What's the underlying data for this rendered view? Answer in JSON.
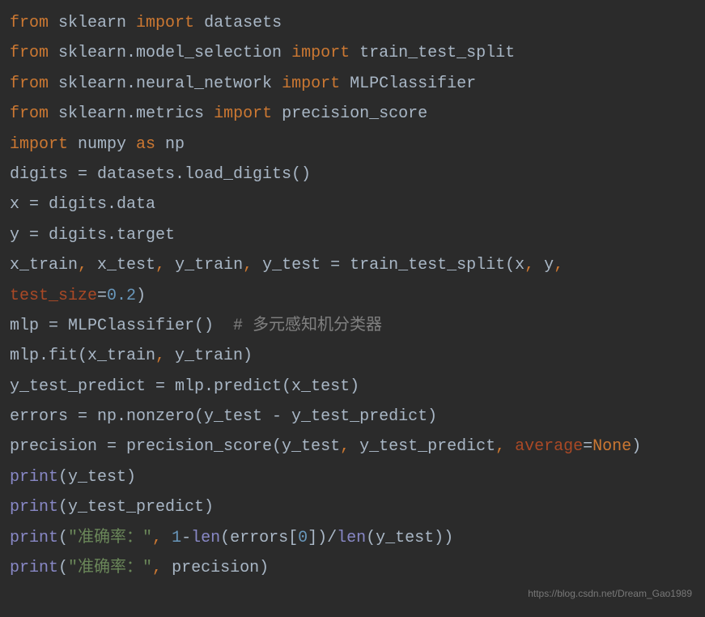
{
  "code": {
    "lines": [
      {
        "tokens": [
          {
            "cls": "kw-import",
            "t": "from"
          },
          {
            "cls": "identifier",
            "t": " sklearn "
          },
          {
            "cls": "kw-import",
            "t": "import"
          },
          {
            "cls": "identifier",
            "t": " datasets"
          }
        ]
      },
      {
        "tokens": [
          {
            "cls": "kw-import",
            "t": "from"
          },
          {
            "cls": "identifier",
            "t": " sklearn.model_selection "
          },
          {
            "cls": "kw-import",
            "t": "import"
          },
          {
            "cls": "identifier",
            "t": " train_test_split"
          }
        ]
      },
      {
        "tokens": [
          {
            "cls": "kw-import",
            "t": "from"
          },
          {
            "cls": "identifier",
            "t": " sklearn.neural_network "
          },
          {
            "cls": "kw-import",
            "t": "import"
          },
          {
            "cls": "identifier",
            "t": " MLPClassifier"
          }
        ]
      },
      {
        "tokens": [
          {
            "cls": "kw-import",
            "t": "from"
          },
          {
            "cls": "identifier",
            "t": " sklearn.metrics "
          },
          {
            "cls": "kw-import",
            "t": "import"
          },
          {
            "cls": "identifier",
            "t": " precision_score"
          }
        ]
      },
      {
        "tokens": [
          {
            "cls": "kw-import",
            "t": "import"
          },
          {
            "cls": "identifier",
            "t": " numpy "
          },
          {
            "cls": "kw-as",
            "t": "as"
          },
          {
            "cls": "identifier",
            "t": " np"
          }
        ]
      },
      {
        "tokens": [
          {
            "cls": "identifier",
            "t": "digits = datasets.load_digits()"
          }
        ]
      },
      {
        "tokens": [
          {
            "cls": "identifier",
            "t": "x = digits.data"
          }
        ]
      },
      {
        "tokens": [
          {
            "cls": "identifier",
            "t": "y = digits.target"
          }
        ]
      },
      {
        "tokens": [
          {
            "cls": "identifier",
            "t": "x_train"
          },
          {
            "cls": "kw-import",
            "t": ", "
          },
          {
            "cls": "identifier",
            "t": "x_test"
          },
          {
            "cls": "kw-import",
            "t": ", "
          },
          {
            "cls": "identifier",
            "t": "y_train"
          },
          {
            "cls": "kw-import",
            "t": ", "
          },
          {
            "cls": "identifier",
            "t": "y_test = train_test_split(x"
          },
          {
            "cls": "kw-import",
            "t": ", "
          },
          {
            "cls": "identifier",
            "t": "y"
          },
          {
            "cls": "kw-import",
            "t": ", "
          },
          {
            "cls": "param",
            "t": "test_size"
          },
          {
            "cls": "identifier",
            "t": "="
          },
          {
            "cls": "number",
            "t": "0.2"
          },
          {
            "cls": "identifier",
            "t": ")"
          }
        ]
      },
      {
        "tokens": [
          {
            "cls": "identifier",
            "t": "mlp = MLPClassifier()  "
          },
          {
            "cls": "comment",
            "t": "# 多元感知机分类器"
          }
        ]
      },
      {
        "tokens": [
          {
            "cls": "identifier",
            "t": "mlp.fit(x_train"
          },
          {
            "cls": "kw-import",
            "t": ", "
          },
          {
            "cls": "identifier",
            "t": "y_train)"
          }
        ]
      },
      {
        "tokens": [
          {
            "cls": "identifier",
            "t": "y_test_predict = mlp.predict(x_test)"
          }
        ]
      },
      {
        "tokens": [
          {
            "cls": "identifier",
            "t": "errors = np.nonzero(y_test - y_test_predict)"
          }
        ]
      },
      {
        "tokens": [
          {
            "cls": "identifier",
            "t": "precision = precision_score(y_test"
          },
          {
            "cls": "kw-import",
            "t": ", "
          },
          {
            "cls": "identifier",
            "t": "y_test_predict"
          },
          {
            "cls": "kw-import",
            "t": ", "
          },
          {
            "cls": "param",
            "t": "average"
          },
          {
            "cls": "identifier",
            "t": "="
          },
          {
            "cls": "kw-none",
            "t": "None"
          },
          {
            "cls": "identifier",
            "t": ")"
          }
        ]
      },
      {
        "tokens": [
          {
            "cls": "builtin",
            "t": "print"
          },
          {
            "cls": "identifier",
            "t": "(y_test)"
          }
        ]
      },
      {
        "tokens": [
          {
            "cls": "builtin",
            "t": "print"
          },
          {
            "cls": "identifier",
            "t": "(y_test_predict)"
          }
        ]
      },
      {
        "tokens": [
          {
            "cls": "builtin",
            "t": "print"
          },
          {
            "cls": "identifier",
            "t": "("
          },
          {
            "cls": "string",
            "t": "\"准确率：\""
          },
          {
            "cls": "kw-import",
            "t": ", "
          },
          {
            "cls": "number",
            "t": "1"
          },
          {
            "cls": "identifier",
            "t": "-"
          },
          {
            "cls": "builtin",
            "t": "len"
          },
          {
            "cls": "identifier",
            "t": "(errors["
          },
          {
            "cls": "number",
            "t": "0"
          },
          {
            "cls": "identifier",
            "t": "])/"
          },
          {
            "cls": "builtin",
            "t": "len"
          },
          {
            "cls": "identifier",
            "t": "(y_test))"
          }
        ]
      },
      {
        "tokens": [
          {
            "cls": "builtin",
            "t": "print"
          },
          {
            "cls": "identifier",
            "t": "("
          },
          {
            "cls": "string",
            "t": "\"准确率：\""
          },
          {
            "cls": "kw-import",
            "t": ", "
          },
          {
            "cls": "identifier",
            "t": "precision)"
          }
        ]
      }
    ]
  },
  "watermark": "https://blog.csdn.net/Dream_Gao1989"
}
